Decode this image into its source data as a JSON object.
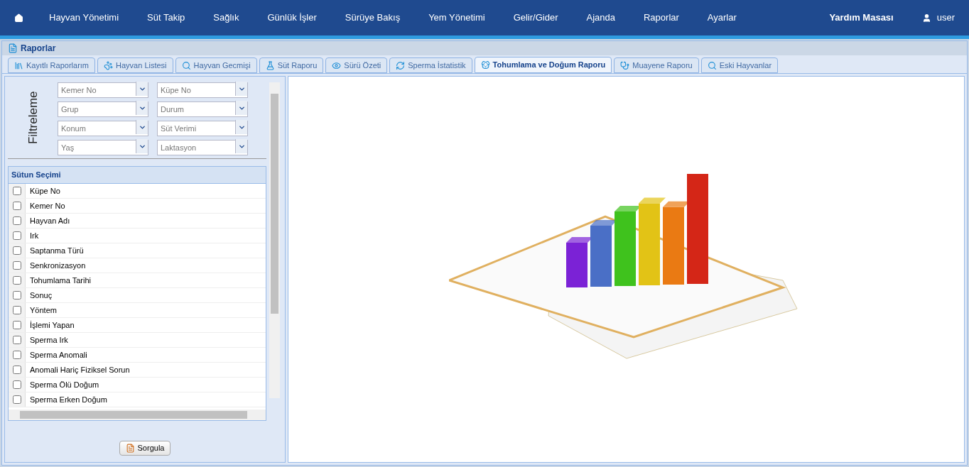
{
  "nav": {
    "items": [
      "Hayvan Yönetimi",
      "Süt Takip",
      "Sağlık",
      "Günlük İşler",
      "Sürüye Bakış",
      "Yem Yönetimi",
      "Gelir/Gider",
      "Ajanda",
      "Raporlar",
      "Ayarlar"
    ],
    "help": "Yardım Masası",
    "user": "user"
  },
  "panel": {
    "title": "Raporlar"
  },
  "tabs": [
    {
      "label": "Kayıtlı Raporlarım",
      "selected": false
    },
    {
      "label": "Hayvan Listesi",
      "selected": false
    },
    {
      "label": "Hayvan Gecmişi",
      "selected": false
    },
    {
      "label": "Süt Raporu",
      "selected": false
    },
    {
      "label": "Sürü Özeti",
      "selected": false
    },
    {
      "label": "Sperma İstatistik",
      "selected": false
    },
    {
      "label": "Tohumlama ve Doğum Raporu",
      "selected": true
    },
    {
      "label": "Muayene Raporu",
      "selected": false
    },
    {
      "label": "Eski Hayvanlar",
      "selected": false
    }
  ],
  "filter": {
    "title": "Filtreleme",
    "fields": [
      {
        "placeholder": "Kemer No"
      },
      {
        "placeholder": "Küpe No"
      },
      {
        "placeholder": "Grup"
      },
      {
        "placeholder": "Durum"
      },
      {
        "placeholder": "Konum"
      },
      {
        "placeholder": "Süt Verimi"
      },
      {
        "placeholder": "Yaş"
      },
      {
        "placeholder": "Laktasyon"
      }
    ]
  },
  "columns": {
    "title": "Sütun Seçimi",
    "items": [
      {
        "label": "Küpe No",
        "checked": false
      },
      {
        "label": "Kemer No",
        "checked": false
      },
      {
        "label": "Hayvan Adı",
        "checked": false
      },
      {
        "label": "Irk",
        "checked": false
      },
      {
        "label": "Saptanma Türü",
        "checked": false
      },
      {
        "label": "Senkronizasyon",
        "checked": false
      },
      {
        "label": "Tohumlama Tarihi",
        "checked": false
      },
      {
        "label": "Sonuç",
        "checked": false
      },
      {
        "label": "Yöntem",
        "checked": false
      },
      {
        "label": "İşlemi Yapan",
        "checked": false
      },
      {
        "label": "Sperma Irk",
        "checked": false
      },
      {
        "label": "Sperma Anomali",
        "checked": false
      },
      {
        "label": "Anomali Hariç Fiziksel Sorun",
        "checked": false
      },
      {
        "label": "Sperma Ölü Doğum",
        "checked": false
      },
      {
        "label": "Sperma Erken Doğum",
        "checked": false
      }
    ]
  },
  "query_button": "Sorgula"
}
